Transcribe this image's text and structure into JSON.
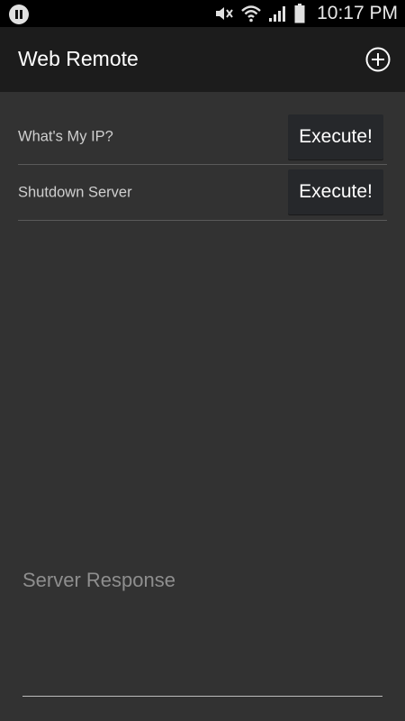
{
  "status_bar": {
    "time": "10:17 PM",
    "icons": [
      "pause-icon",
      "mute-icon",
      "wifi-icon",
      "signal-icon",
      "battery-icon"
    ]
  },
  "action_bar": {
    "title": "Web Remote",
    "add_icon": "add-circle-icon"
  },
  "commands": [
    {
      "label": "What's My IP?",
      "button_label": "Execute!"
    },
    {
      "label": "Shutdown Server",
      "button_label": "Execute!"
    }
  ],
  "response": {
    "placeholder": "Server Response",
    "value": ""
  },
  "colors": {
    "background": "#323232",
    "action_bar": "#1c1c1c",
    "status_bar": "#000000",
    "button": "#26282b",
    "divider": "#5a5a5a",
    "hint_text": "#8e8e8e"
  }
}
